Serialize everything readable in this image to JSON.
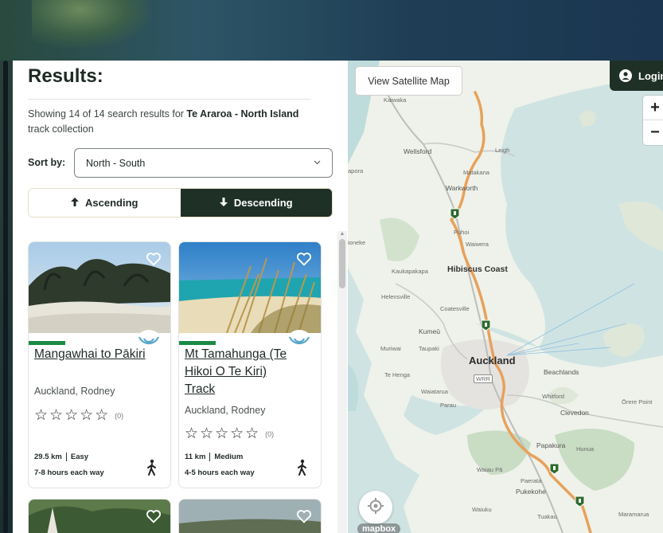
{
  "results": {
    "title": "Results:",
    "summary_prefix": "Showing 14 of 14 search results for ",
    "summary_collection": "Te Araroa - North Island",
    "summary_suffix": " track collection",
    "sort_label": "Sort by:",
    "sort_value": "North - South",
    "ascending_label": "Ascending",
    "descending_label": "Descending",
    "active_order": "Descending"
  },
  "cards": [
    {
      "title": "Mangawhai to Pākiri",
      "location": "Auckland, Rodney",
      "stars": "☆☆☆☆☆",
      "rating_count": "(0)",
      "distance": "29.5 km",
      "difficulty": "Easy",
      "time": "7-8 hours each way"
    },
    {
      "title": "Mt Tamahunga (Te Hikoi O Te Kiri) Track",
      "location": "Auckland, Rodney",
      "stars": "☆☆☆☆☆",
      "rating_count": "(0)",
      "distance": "11 km",
      "difficulty": "Medium",
      "time": "4-5 hours each way"
    }
  ],
  "map": {
    "satellite_button": "View Satellite Map",
    "login_label": "Login",
    "zoom_in": "+",
    "zoom_out": "−",
    "attribution": "mapbox",
    "labels": {
      "kaiwaka": "Kaiwaka",
      "wellsford": "Wellsford",
      "leigh": "Leigh",
      "matakana": "Matakana",
      "warkworth": "Warkworth",
      "apora": "apora",
      "puhoi": "Puhoi",
      "waiwera": "Waiwera",
      "ioneke": "ioneke",
      "kaukapakapa": "Kaukapakapa",
      "hibiscus": "Hibiscus Coast",
      "helensville": "Helensville",
      "coatesville": "Coatesville",
      "kumeu": "Kumeū",
      "muriwai": "Muriwai",
      "taupaki": "Taupaki",
      "auckland": "Auckland",
      "tehenga": "Te Henga",
      "beachlands": "Beachlands",
      "waiatarua": "Waiatarua",
      "parau": "Parau",
      "whitford": "Whitford",
      "orere": "Ōrere Point",
      "clevedon": "Clevedon",
      "papakura": "Papakura",
      "hunua": "Hunua",
      "waiaupa": "Waiau Pā",
      "paerata": "Paerata",
      "pukekohe": "Pukekohe",
      "waiuku": "Waiuku",
      "tuakau": "Tuakau",
      "maramarua": "Maramarua",
      "wrr": "WRR"
    }
  },
  "colors": {
    "primary_dark": "#1f3127",
    "track_orange": "#e8a15a",
    "accent_green": "#1c8a45",
    "badge_blue": "#5aa7c8"
  }
}
